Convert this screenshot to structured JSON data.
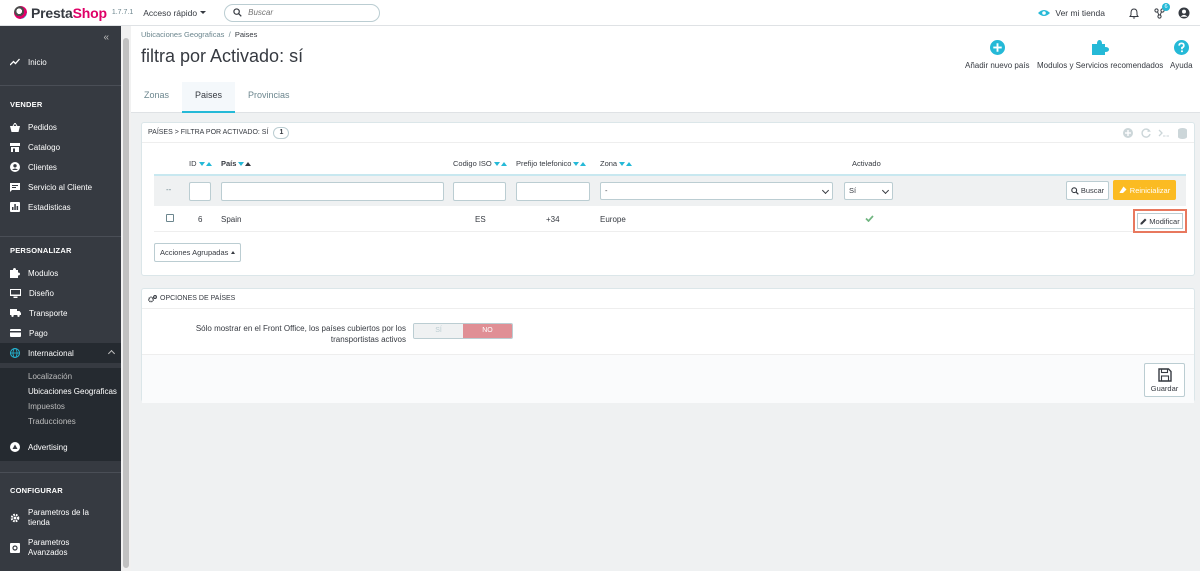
{
  "header": {
    "logo_prefix": "Presta",
    "logo_suffix": "Shop",
    "version": "1.7.7.1",
    "quick_access": "Acceso rápido",
    "search_placeholder": "Buscar",
    "view_store": "Ver mi tienda",
    "notifications_count": "6"
  },
  "sidebar": {
    "inicio": "Inicio",
    "sections": {
      "vender": "VENDER",
      "personalizar": "PERSONALIZAR",
      "configurar": "CONFIGURAR"
    },
    "vender_items": [
      "Pedidos",
      "Catalogo",
      "Clientes",
      "Servicio al Cliente",
      "Estadisticas"
    ],
    "personalizar_items": [
      "Modulos",
      "Diseño",
      "Transporte",
      "Pago",
      "Internacional"
    ],
    "internacional_sub": [
      "Localización",
      "Ubicaciones Geograficas",
      "Impuestos",
      "Traducciones"
    ],
    "advertising": "Advertising",
    "configurar_items": [
      {
        "line1": "Parametros de la",
        "line2": "tienda"
      },
      {
        "line1": "Parametros",
        "line2": "Avanzados"
      }
    ]
  },
  "page": {
    "breadcrumb_parent": "Ubicaciones Geograficas",
    "breadcrumb_sep": "/",
    "breadcrumb_current": "Paises",
    "title": "filtra por Activado: sí",
    "toolbar": {
      "add_country": "Añadir nuevo país",
      "modules": "Modulos y Servicios recomendados",
      "help": "Ayuda"
    },
    "tabs": [
      "Zonas",
      "Paises",
      "Provincias"
    ],
    "active_tab": "Paises"
  },
  "list_panel": {
    "heading": "PAÍSES > FILTRA POR ACTIVADO: SÍ",
    "count": "1",
    "columns": {
      "id": "ID",
      "pais": "País",
      "iso": "Codigo ISO",
      "prefix": "Prefijo telefonico",
      "zona": "Zona",
      "activado": "Activado"
    },
    "filter": {
      "dash": "--",
      "zona_value": "-",
      "activado_value": "Sí",
      "search_btn": "Buscar",
      "reset_btn": "Reinicializar"
    },
    "rows": [
      {
        "id": "6",
        "country": "Spain",
        "iso": "ES",
        "prefix": "+34",
        "zone": "Europe",
        "active": true,
        "edit_btn": "Modificar"
      }
    ],
    "bulk_actions": "Acciones Agrupadas"
  },
  "options_panel": {
    "heading": "OPCIONES DE PAÍSES",
    "label_line1": "Sólo mostrar en el Front Office, los países cubiertos por los",
    "label_line2": "transportistas activos",
    "switch_yes": "SÍ",
    "switch_no": "NO",
    "save_btn": "Guardar"
  },
  "colors": {
    "brand": "#df0067",
    "accent": "#25b9d7",
    "warning": "#fbbb22",
    "success": "#70b580",
    "highlight": "#e8785e"
  }
}
